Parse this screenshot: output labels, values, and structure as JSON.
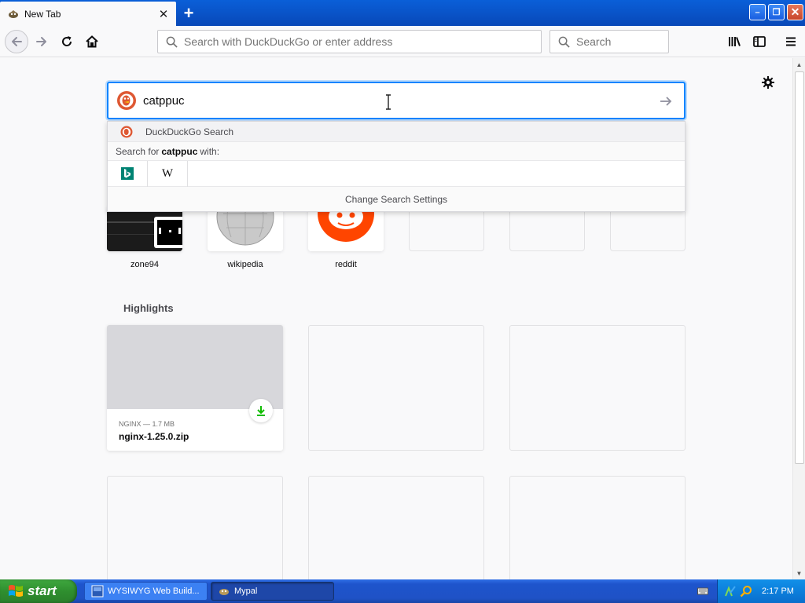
{
  "tab": {
    "title": "New Tab",
    "close_glyph": "✕",
    "favicon": "mypal-icon"
  },
  "newtab": {
    "glyph": "+"
  },
  "window": {
    "min_glyph": "–",
    "max_glyph": "❐",
    "close_glyph": "✕"
  },
  "navbar": {
    "url_placeholder": "Search with DuckDuckGo or enter address",
    "search_placeholder": "Search"
  },
  "newtab_page": {
    "search_value": "catppuc",
    "dropdown": {
      "engine_row": "DuckDuckGo Search",
      "search_for_prefix": "Search for",
      "search_for_term": "catppuc",
      "search_for_suffix": "with:",
      "engines": [
        "bing-icon",
        "wikipedia-icon"
      ],
      "wikipedia_glyph": "W",
      "change_settings": "Change Search Settings"
    },
    "top_sites": [
      {
        "label": "zone94"
      },
      {
        "label": "wikipedia"
      },
      {
        "label": "reddit"
      }
    ],
    "highlights_title": "Highlights",
    "highlight_card": {
      "meta": "NGINX — 1.7 MB",
      "name": "nginx-1.25.0.zip"
    }
  },
  "taskbar": {
    "start_label": "start",
    "tasks": [
      {
        "label": "WYSIWYG Web Build..."
      },
      {
        "label": "Mypal"
      }
    ],
    "clock": "2:17 PM"
  },
  "colors": {
    "accent_blue": "#0a84ff",
    "ddg_orange": "#de5833",
    "reddit_orange": "#ff4500",
    "bing_teal": "#008373",
    "download_green": "#12bc00"
  }
}
